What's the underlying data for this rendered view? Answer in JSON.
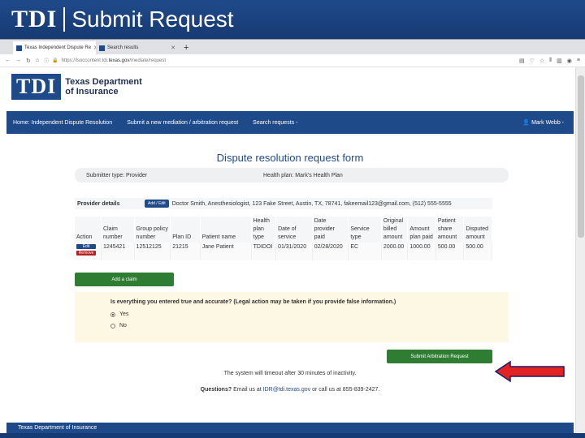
{
  "slide": {
    "logo": "TDI",
    "title": "Submit Request"
  },
  "browser": {
    "tabs": [
      {
        "label": "Texas Independent Dispute Re"
      },
      {
        "label": "Search results"
      }
    ],
    "url_prefix": "https://lsoccontent.tdi.",
    "url_domain": "texas.gov",
    "url_path": "/mediate/request"
  },
  "site": {
    "logo_short": "TDI",
    "logo_line1": "Texas Department",
    "logo_line2": "of Insurance",
    "nav": {
      "home": "Home: Independent Dispute Resolution",
      "submit": "Submit a new mediation / arbitration request",
      "search": "Search requests -",
      "user": "Mark Webb -"
    }
  },
  "form": {
    "title": "Dispute resolution request form",
    "submitter_type": "Submitter type: Provider",
    "health_plan": "Health plan: Mark's Health Plan",
    "provider_label": "Provider details",
    "provider_btn": "Add / Edit",
    "provider_details": "Doctor Smith, Anesthesiologist, 123 Fake Street, Austin, TX, 78741, fakeemail123@gmail.com, (512) 555-5555",
    "columns": [
      "Action",
      "Claim number",
      "Group policy number",
      "Plan ID",
      "Patient name",
      "Health plan type",
      "Date of service",
      "Date provider paid",
      "Service type",
      "Original billed amount",
      "Amount plan paid",
      "Patient share amount",
      "Disputed amount"
    ],
    "row": {
      "edit": "Edit",
      "remove": "Remove",
      "claim_number": "1245421",
      "group_policy": "12512125",
      "plan_id": "21215",
      "patient_name": "Jane Patient",
      "plan_type": "TDIDOI",
      "date_service": "01/31/2020",
      "date_paid": "02/28/2020",
      "service_type": "EC",
      "billed": "2000.00",
      "plan_paid": "1000.00",
      "patient_share": "500.00",
      "disputed": "500.00"
    },
    "add_claim": "Add a claim",
    "attest_question": "Is everything you entered true and accurate? (Legal action may be taken if you provide false information.)",
    "option_yes": "Yes",
    "option_no": "No",
    "submit": "Submit Arbitration Request",
    "timeout": "The system will timeout after 30 minutes of inactivity.",
    "questions_label": "Questions?",
    "questions_text1": " Email us at ",
    "questions_email": "IDR@tdi.texas.gov",
    "questions_text2": " or call us at 855-839-2427.",
    "footer": "Texas Department of Insurance"
  },
  "colors": {
    "brand": "#1f4a8a",
    "success": "#2e7d32",
    "danger": "#b22222",
    "arrow": "#e32222"
  }
}
